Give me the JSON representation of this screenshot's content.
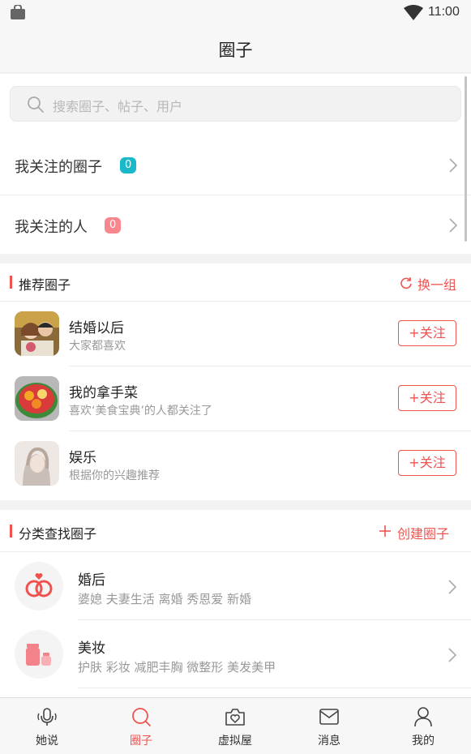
{
  "status": {
    "time": "11:00"
  },
  "header": {
    "title": "圈子"
  },
  "search": {
    "placeholder": "搜索圈子、帖子、用户"
  },
  "my_rows": [
    {
      "label": "我关注的圈子",
      "count": "0",
      "badge_color": "#1ab8c8"
    },
    {
      "label": "我关注的人",
      "count": "0",
      "badge_color": "#f7868e"
    }
  ],
  "recommended": {
    "title": "推荐圈子",
    "action": "换一组",
    "follow_label": "+关注",
    "items": [
      {
        "name": "结婚以后",
        "desc": "大家都喜欢"
      },
      {
        "name": "我的拿手菜",
        "desc": "喜欢‘美食宝典’的人都关注了"
      },
      {
        "name": "娱乐",
        "desc": "根据你的兴趣推荐"
      }
    ]
  },
  "categories": {
    "title": "分类查找圈子",
    "action": "创建圈子",
    "items": [
      {
        "name": "婚后",
        "tags": "婆媳 夫妻生活 离婚 秀恩爱 新婚",
        "icon": "rings-icon"
      },
      {
        "name": "美妆",
        "tags": "护肤 彩妆 减肥丰胸 微整形 美发美甲",
        "icon": "cosmetics-icon"
      }
    ]
  },
  "tabs": [
    {
      "label": "她说",
      "icon": "microphone-icon"
    },
    {
      "label": "圈子",
      "icon": "search-icon",
      "active": true
    },
    {
      "label": "虚拟屋",
      "icon": "camera-heart-icon"
    },
    {
      "label": "消息",
      "icon": "envelope-icon"
    },
    {
      "label": "我的",
      "icon": "person-icon"
    }
  ],
  "colors": {
    "accent": "#ef5350",
    "teal": "#1ab8c8",
    "pink_badge": "#f7868e"
  }
}
